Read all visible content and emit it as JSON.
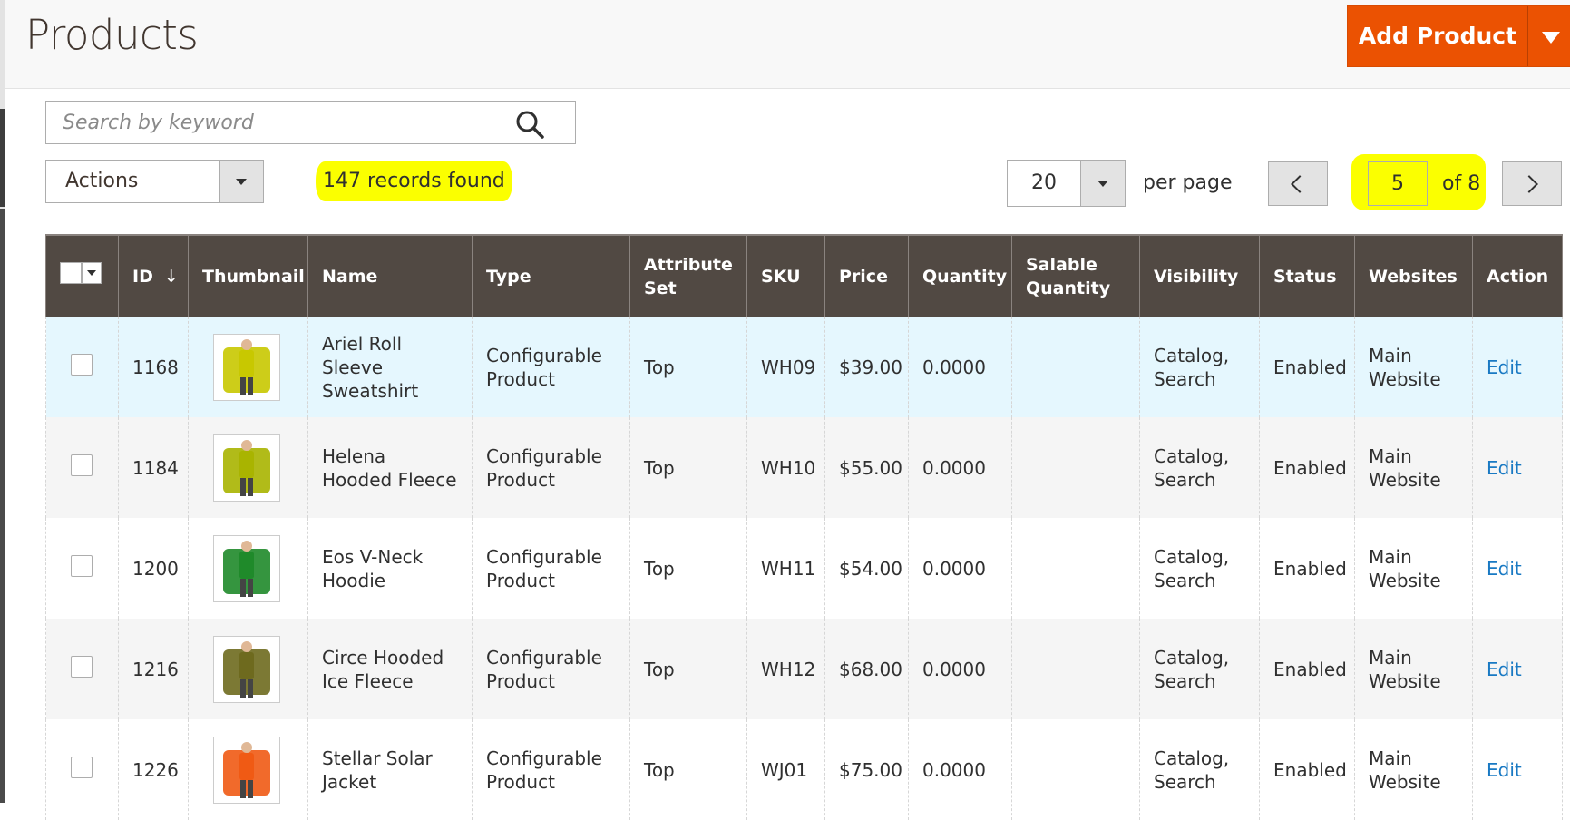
{
  "header": {
    "title": "Products",
    "add_button": "Add Product"
  },
  "search": {
    "placeholder": "Search by keyword"
  },
  "toolbar": {
    "actions_label": "Actions",
    "records_found": "147 records found",
    "per_page_value": "20",
    "per_page_label": "per page",
    "current_page": "5",
    "total_pages_label": "of 8"
  },
  "table": {
    "columns": [
      "ID",
      "Thumbnail",
      "Name",
      "Type",
      "Attribute Set",
      "SKU",
      "Price",
      "Quantity",
      "Salable Quantity",
      "Visibility",
      "Status",
      "Websites",
      "Action"
    ],
    "sort_indicator": "↓",
    "rows": [
      {
        "id": "1168",
        "thumb_color": "#c8c800",
        "name": "Ariel Roll Sleeve Sweatshirt",
        "type": "Configurable Product",
        "attribute_set": "Top",
        "sku": "WH09",
        "price": "$39.00",
        "quantity": "0.0000",
        "salable_quantity": "",
        "visibility": "Catalog, Search",
        "status": "Enabled",
        "websites": "Main Website",
        "action": "Edit"
      },
      {
        "id": "1184",
        "thumb_color": "#a9b400",
        "name": "Helena Hooded Fleece",
        "type": "Configurable Product",
        "attribute_set": "Top",
        "sku": "WH10",
        "price": "$55.00",
        "quantity": "0.0000",
        "salable_quantity": "",
        "visibility": "Catalog, Search",
        "status": "Enabled",
        "websites": "Main Website",
        "action": "Edit"
      },
      {
        "id": "1200",
        "thumb_color": "#1f8a2a",
        "name": "Eos V-Neck Hoodie",
        "type": "Configurable Product",
        "attribute_set": "Top",
        "sku": "WH11",
        "price": "$54.00",
        "quantity": "0.0000",
        "salable_quantity": "",
        "visibility": "Catalog, Search",
        "status": "Enabled",
        "websites": "Main Website",
        "action": "Edit"
      },
      {
        "id": "1216",
        "thumb_color": "#6e6a1e",
        "name": "Circe Hooded Ice Fleece",
        "type": "Configurable Product",
        "attribute_set": "Top",
        "sku": "WH12",
        "price": "$68.00",
        "quantity": "0.0000",
        "salable_quantity": "",
        "visibility": "Catalog, Search",
        "status": "Enabled",
        "websites": "Main Website",
        "action": "Edit"
      },
      {
        "id": "1226",
        "thumb_color": "#f05a14",
        "name": "Stellar Solar Jacket",
        "type": "Configurable Product",
        "attribute_set": "Top",
        "sku": "WJ01",
        "price": "$75.00",
        "quantity": "0.0000",
        "salable_quantity": "",
        "visibility": "Catalog, Search",
        "status": "Enabled",
        "websites": "Main Website",
        "action": "Edit"
      }
    ]
  },
  "colors": {
    "accent": "#eb5202",
    "header_bg": "#514943",
    "link": "#1979c3",
    "highlight": "#fbff00"
  }
}
